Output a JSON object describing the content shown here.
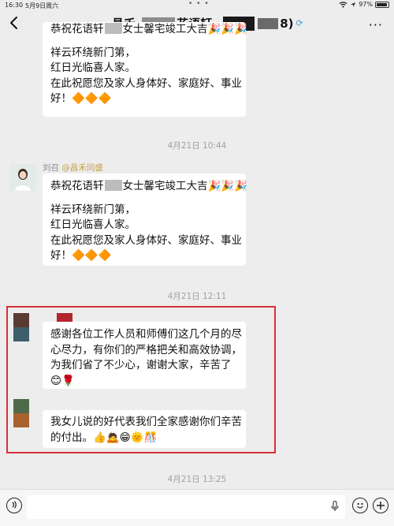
{
  "status_bar": {
    "time": "16:30",
    "date": "5月9日周六",
    "dots": "• • •",
    "battery": "97%"
  },
  "nav": {
    "title_prefix": "昌禾-",
    "title_mid": "花语轩",
    "member_count_suffix": "8)"
  },
  "messages": {
    "msg1": {
      "line_top": "恭祝花语轩",
      "line_top_suffix": "女士馨宅竣工大吉🎉🎉🎉",
      "l1": "祥云环绕新门第，",
      "l2": "红日光临喜人家。",
      "l3": "在此祝愿您及家人身体好、家庭好、事业",
      "l4": "好！🔶🔶🔶"
    },
    "time1": "4月21日 10:44",
    "msg2": {
      "sender": "刘召",
      "source": "@昌禾同盛",
      "line_top": "恭祝花语轩",
      "line_top_suffix": "女士馨宅竣工大吉🎉🎉🎉",
      "l1": "祥云环绕新门第，",
      "l2": "红日光临喜人家。",
      "l3": "在此祝愿您及家人身体好、家庭好、事业",
      "l4": "好！🔶🔶🔶"
    },
    "time2": "4月21日 12:11",
    "msg3": {
      "l1": "感谢各位工作人员和师傅们这几个月的尽",
      "l2": "心尽力，有你们的严格把关和高效协调，",
      "l3": "为我们省了不少心，谢谢大家，辛苦了",
      "l4": "😊🌹"
    },
    "msg4": {
      "l1": "我女儿说的好代表我们全家感谢你们辛苦",
      "l2": "的付出。👍🙇😁🌞🎊"
    },
    "time3": "4月21日 13:25"
  },
  "input": {
    "placeholder": ""
  },
  "colors": {
    "highlight": "#d9303a",
    "background": "#ededed",
    "bubble": "#ffffff",
    "timestamp": "#a0a0a0"
  }
}
